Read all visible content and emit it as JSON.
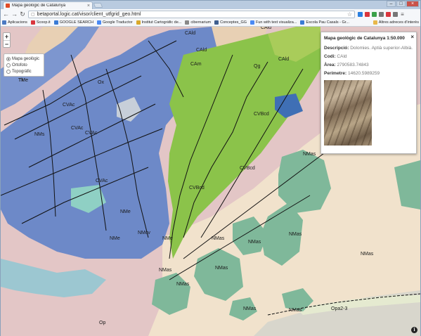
{
  "browser": {
    "tab_title": "Mapa geològic de Catalunya",
    "url": "betaportal.logic.cat/visor/client_utfgrid_geo.html",
    "colors": {
      "frame": "#b9cbe0",
      "close": "#c9524a"
    }
  },
  "bookmarks": [
    {
      "label": "Aplicacions",
      "color": "#4b79c2"
    },
    {
      "label": "Scoop.it",
      "color": "#d9363e"
    },
    {
      "label": "GOOGLE SEARCH",
      "color": "#3a7bd5"
    },
    {
      "label": "Google Traductor",
      "color": "#4a8af4"
    },
    {
      "label": "Institut Cartogràfic de...",
      "color": "#d9a92b"
    },
    {
      "label": "cibernarium",
      "color": "#888888"
    },
    {
      "label": "Conceptes_GG",
      "color": "#3f5f8f"
    },
    {
      "label": "Fun with text visualiza...",
      "color": "#4a8af4"
    },
    {
      "label": "Escola Pau Casals - Gr...",
      "color": "#3a7bd5"
    }
  ],
  "bookmarks_other": {
    "label": "Altres adreces d'interès",
    "color": "#e8b84a"
  },
  "map": {
    "zoom_in": "+",
    "zoom_out": "−",
    "layers": [
      {
        "label": "Mapa geològic",
        "selected": true
      },
      {
        "label": "Ortofoto",
        "selected": false
      },
      {
        "label": "Topogràfic",
        "selected": false
      }
    ],
    "unit_labels": [
      "Tk",
      "CVAc",
      "CVAc",
      "CVAc",
      "CVAc",
      "CAld",
      "CAld",
      "CAm",
      "CAld",
      "CAld",
      "CVBcd",
      "CVBcd",
      "CVBcd",
      "NMs",
      "NMas",
      "NMas",
      "NMas",
      "NMas",
      "NMas",
      "NMas",
      "NMas",
      "NMe",
      "NMe",
      "NMe",
      "NMcv",
      "NMas",
      "NMas",
      "NMas",
      "Opa2-3",
      "Op",
      "Qg",
      "Ox",
      "Tk",
      "TMe"
    ],
    "colors": {
      "pink": "#e3c6c6",
      "blue": "#6d89c8",
      "green": "#8bc34a",
      "teal": "#7fb89a",
      "tan": "#e8d0b4",
      "cream": "#f1e2cc",
      "grey": "#d8d6cc"
    }
  },
  "popup": {
    "title": "Mapa geològic de Catalunya 1:50.000",
    "descripcio_label": "Descripció:",
    "descripcio_value": "Dolomies. Aptià superior-Albià.",
    "codi_label": "Codi:",
    "codi_value": "CAld",
    "area_label": "Àrea:",
    "area_value": "2790583.74843",
    "perimetre_label": "Perímetre:",
    "perimetre_value": "14620.5989259"
  }
}
